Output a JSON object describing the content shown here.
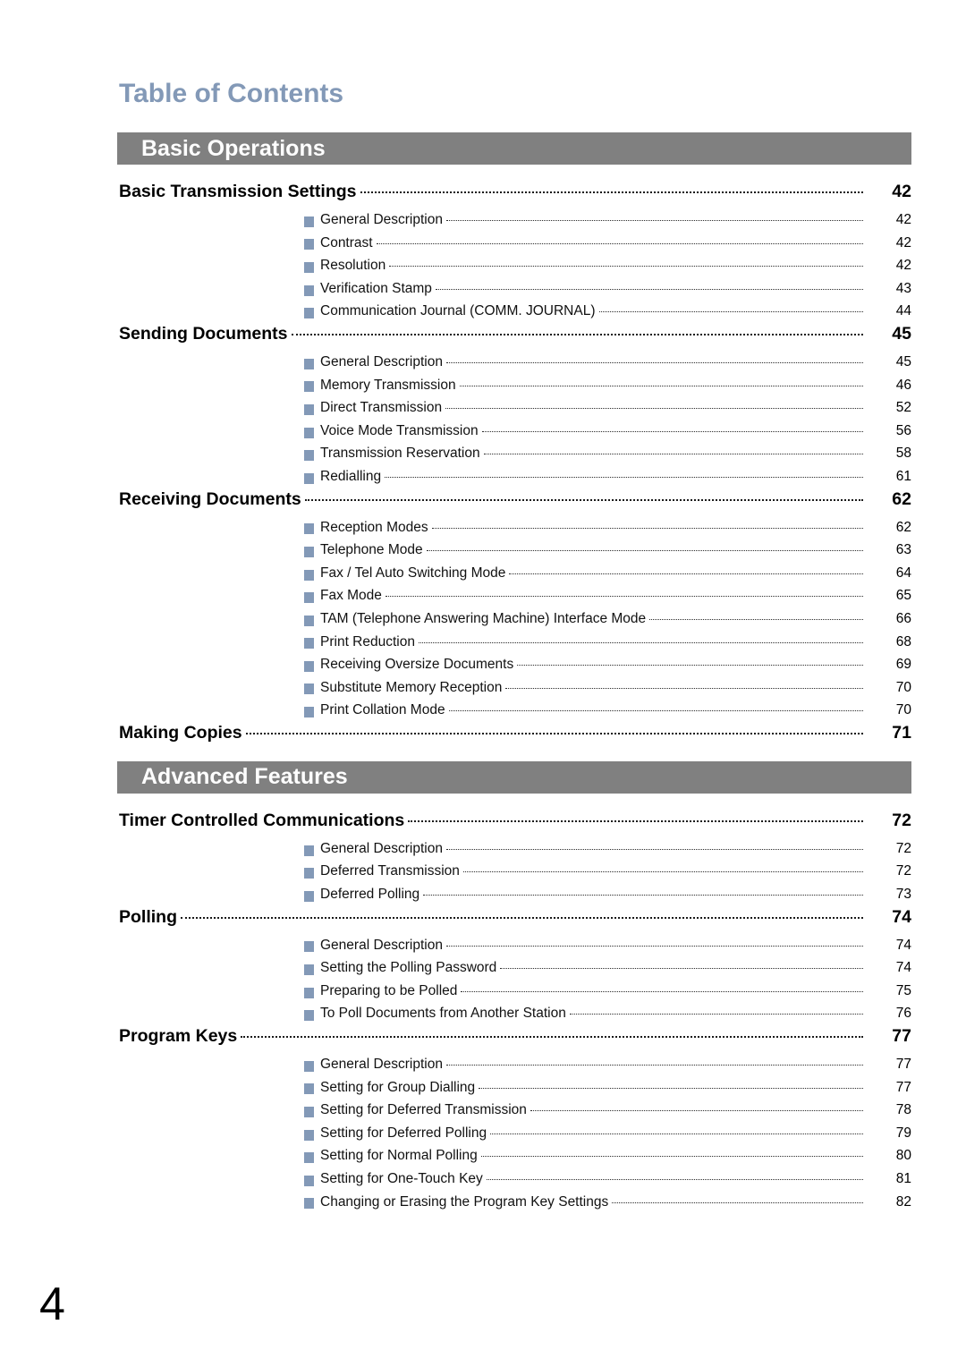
{
  "document": {
    "title": "Table of Contents",
    "folio": "4"
  },
  "sections": [
    {
      "band_label": "Basic Operations",
      "entries": [
        {
          "type": "main",
          "label": "Basic Transmission Settings",
          "page": "42"
        },
        {
          "type": "sub",
          "label": "General Description",
          "page": "42"
        },
        {
          "type": "sub",
          "label": "Contrast",
          "page": "42"
        },
        {
          "type": "sub",
          "label": "Resolution",
          "page": "42"
        },
        {
          "type": "sub",
          "label": "Verification Stamp",
          "page": "43"
        },
        {
          "type": "sub",
          "label": "Communication Journal (COMM. JOURNAL)",
          "page": "44"
        },
        {
          "type": "main",
          "label": "Sending Documents",
          "page": "45"
        },
        {
          "type": "sub",
          "label": "General Description",
          "page": "45"
        },
        {
          "type": "sub",
          "label": "Memory Transmission",
          "page": "46"
        },
        {
          "type": "sub",
          "label": "Direct Transmission",
          "page": "52"
        },
        {
          "type": "sub",
          "label": "Voice Mode Transmission",
          "page": "56"
        },
        {
          "type": "sub",
          "label": "Transmission Reservation",
          "page": "58"
        },
        {
          "type": "sub",
          "label": "Redialling",
          "page": "61"
        },
        {
          "type": "main",
          "label": "Receiving Documents",
          "page": "62"
        },
        {
          "type": "sub",
          "label": "Reception Modes",
          "page": "62"
        },
        {
          "type": "sub",
          "label": "Telephone Mode",
          "page": "63"
        },
        {
          "type": "sub",
          "label": "Fax / Tel Auto Switching Mode",
          "page": "64"
        },
        {
          "type": "sub",
          "label": "Fax Mode",
          "page": "65"
        },
        {
          "type": "sub",
          "label": "TAM (Telephone Answering Machine) Interface Mode",
          "page": "66"
        },
        {
          "type": "sub",
          "label": "Print Reduction",
          "page": "68"
        },
        {
          "type": "sub",
          "label": "Receiving Oversize Documents",
          "page": "69"
        },
        {
          "type": "sub",
          "label": "Substitute Memory Reception",
          "page": "70"
        },
        {
          "type": "sub",
          "label": "Print Collation Mode",
          "page": "70"
        },
        {
          "type": "main",
          "label": "Making Copies",
          "page": "71"
        }
      ]
    },
    {
      "band_label": "Advanced Features",
      "entries": [
        {
          "type": "main",
          "label": "Timer Controlled Communications",
          "page": "72"
        },
        {
          "type": "sub",
          "label": "General Description",
          "page": "72"
        },
        {
          "type": "sub",
          "label": "Deferred Transmission",
          "page": "72"
        },
        {
          "type": "sub",
          "label": "Deferred Polling",
          "page": "73"
        },
        {
          "type": "main",
          "label": "Polling",
          "page": "74"
        },
        {
          "type": "sub",
          "label": "General Description",
          "page": "74"
        },
        {
          "type": "sub",
          "label": "Setting the Polling Password",
          "page": "74"
        },
        {
          "type": "sub",
          "label": "Preparing to be Polled",
          "page": "75"
        },
        {
          "type": "sub",
          "label": "To Poll Documents from Another Station",
          "page": "76"
        },
        {
          "type": "main",
          "label": "Program Keys",
          "page": "77"
        },
        {
          "type": "sub",
          "label": "General Description",
          "page": "77"
        },
        {
          "type": "sub",
          "label": "Setting for Group Dialling",
          "page": "77"
        },
        {
          "type": "sub",
          "label": "Setting for Deferred Transmission",
          "page": "78"
        },
        {
          "type": "sub",
          "label": "Setting for Deferred Polling",
          "page": "79"
        },
        {
          "type": "sub",
          "label": "Setting for Normal Polling",
          "page": "80"
        },
        {
          "type": "sub",
          "label": "Setting for One-Touch Key",
          "page": "81"
        },
        {
          "type": "sub",
          "label": "Changing or Erasing the Program Key Settings",
          "page": "82"
        }
      ]
    }
  ],
  "colors": {
    "title_blue": "#8399b7",
    "band_gray": "#808080",
    "bullet_blue": "#8399b7"
  }
}
